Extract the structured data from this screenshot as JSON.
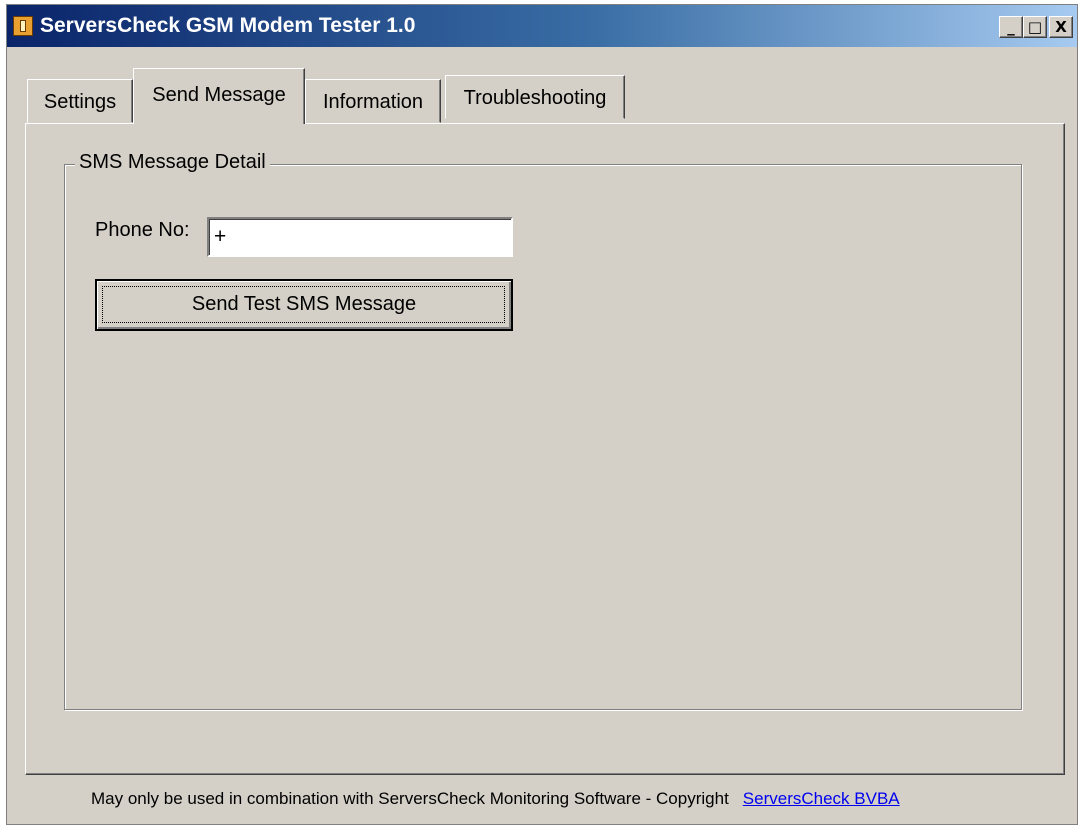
{
  "window": {
    "title": "ServersCheck GSM Modem Tester 1.0",
    "controls": {
      "minimize": "_",
      "maximize": "□",
      "close": "X"
    }
  },
  "tabs": [
    {
      "label": "Settings",
      "active": false
    },
    {
      "label": "Send Message",
      "active": true
    },
    {
      "label": "Information",
      "active": false
    },
    {
      "label": "Troubleshooting",
      "active": false
    }
  ],
  "sms_group": {
    "legend": "SMS Message Detail",
    "phone_label": "Phone No:",
    "phone_value": "+",
    "send_button": "Send Test SMS Message"
  },
  "footer": {
    "text": "May only be used in combination with  ServersCheck Monitoring Software - Copyright",
    "link": "ServersCheck BVBA"
  },
  "colors": {
    "face": "#d4d0c8",
    "titlebar_start": "#0a246a",
    "titlebar_end": "#a6caf0",
    "link": "#0000ee"
  }
}
